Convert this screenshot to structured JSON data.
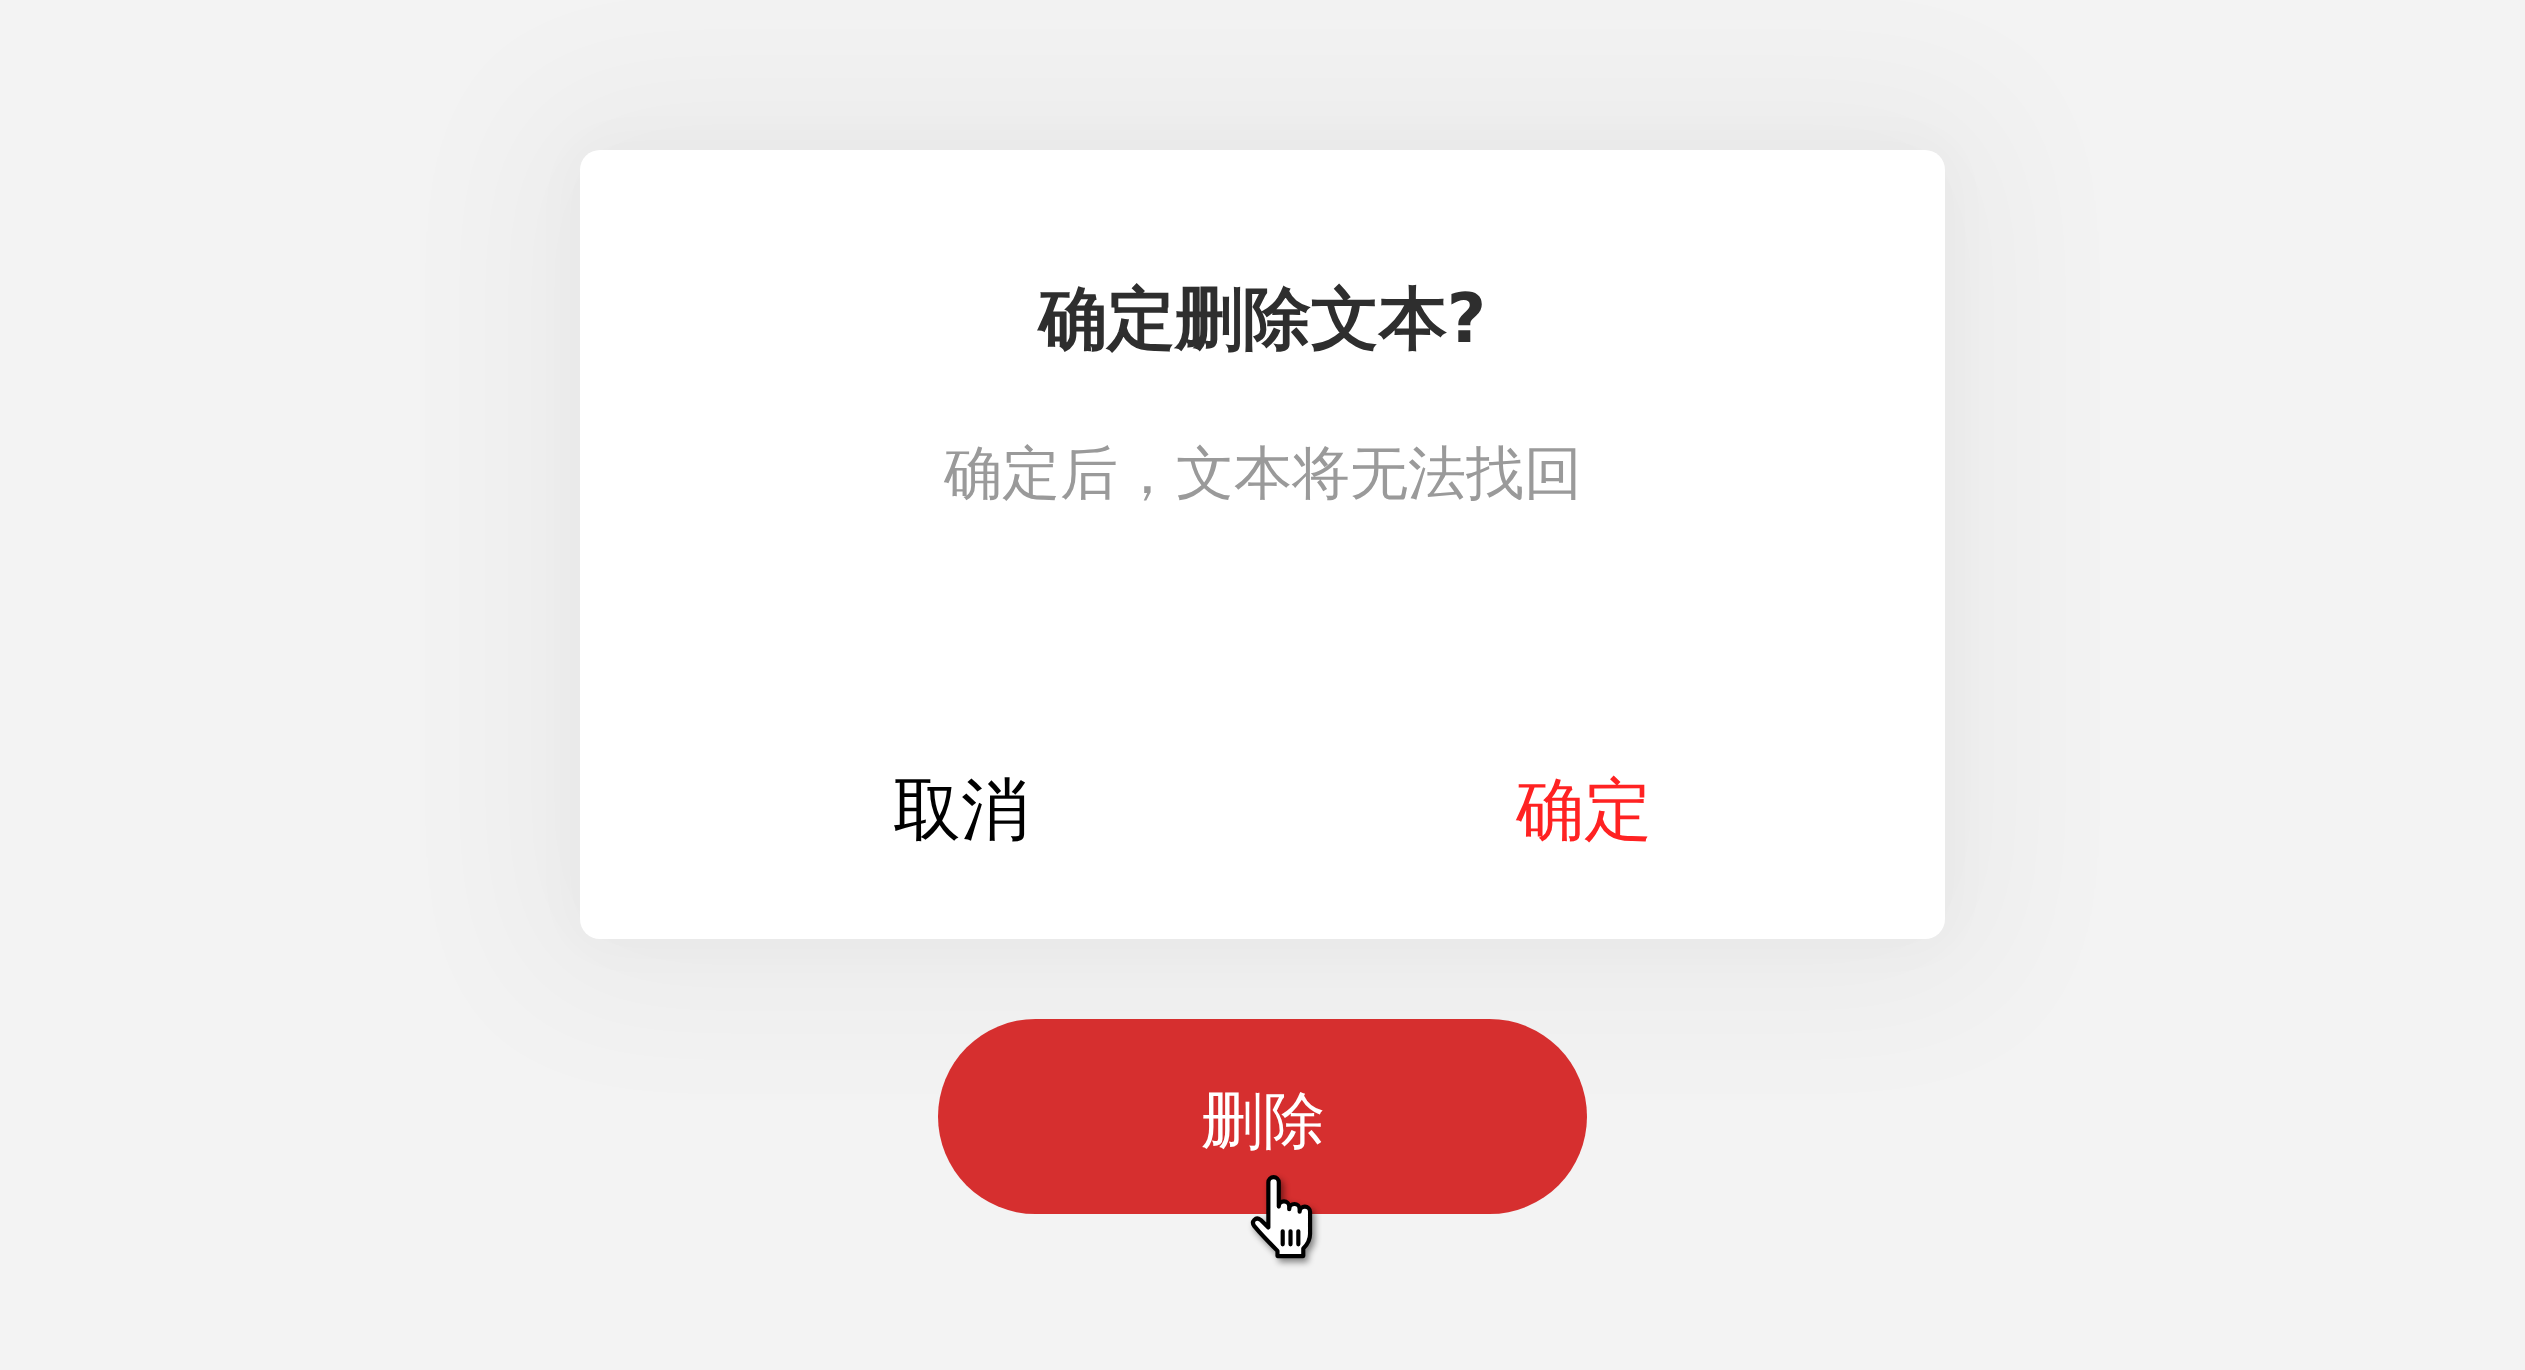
{
  "dialog": {
    "title": "确定删除文本?",
    "message": "确定后，文本将无法找回",
    "buttons": [
      {
        "label": "取消",
        "kind": "cancel"
      },
      {
        "label": "确定",
        "kind": "confirm"
      }
    ]
  },
  "delete_button": {
    "label": "删除"
  }
}
